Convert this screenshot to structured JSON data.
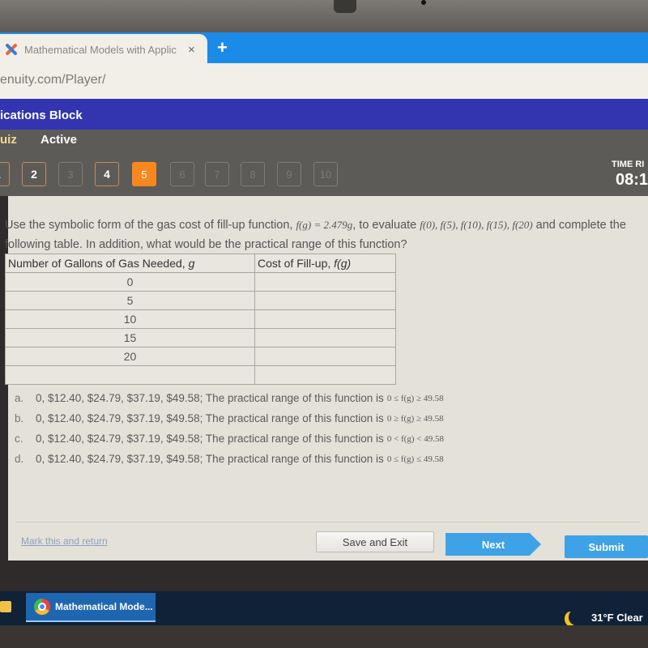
{
  "browser": {
    "tab_title": "Mathematical Models with Applic",
    "tab_close": "×",
    "new_tab": "+",
    "url": "enuity.com/Player/"
  },
  "course": {
    "title": "ications Block",
    "quiz_label": "uiz",
    "status": "Active"
  },
  "question_nav": [
    {
      "label": "1",
      "state": "answered"
    },
    {
      "label": "2",
      "state": "answered"
    },
    {
      "label": "3",
      "state": "unanswered"
    },
    {
      "label": "4",
      "state": "answered"
    },
    {
      "label": "5",
      "state": "current"
    },
    {
      "label": "6",
      "state": "unanswered"
    },
    {
      "label": "7",
      "state": "unanswered"
    },
    {
      "label": "8",
      "state": "unanswered"
    },
    {
      "label": "9",
      "state": "unanswered"
    },
    {
      "label": "10",
      "state": "unanswered"
    }
  ],
  "timer": {
    "label": "TIME RI",
    "value": "08:1"
  },
  "question": {
    "text_part1": "Use the symbolic form of the gas cost of fill-up function, ",
    "function_expr": "f(g) = 2.479g",
    "text_part2": ", to evaluate ",
    "evaluations": "f(0), f(5), f(10), f(15), f(20)",
    "text_part3": " and complete the following table. In addition, what would be the practical range of this function?"
  },
  "table": {
    "headers": [
      "Number of Gallons of Gas Needed, ",
      "Cost of Fill-up, "
    ],
    "header_vars": [
      "g",
      "f(g)"
    ],
    "rows": [
      {
        "g": "0",
        "f": ""
      },
      {
        "g": "5",
        "f": ""
      },
      {
        "g": "10",
        "f": ""
      },
      {
        "g": "15",
        "f": ""
      },
      {
        "g": "20",
        "f": ""
      },
      {
        "g": "",
        "f": ""
      }
    ]
  },
  "choices": [
    {
      "letter": "a.",
      "text": "0, $12.40, $24.79, $37.19, $49.58; The practical range of this function is",
      "range": "0 ≤ f(g) ≥ 49.58"
    },
    {
      "letter": "b.",
      "text": "0, $12.40, $24.79, $37.19, $49.58; The practical range of this function is",
      "range": "0 ≥ f(g) ≥ 49.58"
    },
    {
      "letter": "c.",
      "text": "0, $12.40, $24.79, $37.19, $49.58; The practical range of this function is",
      "range": "0 < f(g) < 49.58"
    },
    {
      "letter": "d.",
      "text": "0, $12.40, $24.79, $37.19, $49.58; The practical range of this function is",
      "range": "0 ≤ f(g) ≤ 49.58"
    }
  ],
  "footer": {
    "mark_link": "Mark this and return",
    "save_exit": "Save and Exit",
    "next": "Next",
    "submit": "Submit"
  },
  "taskbar": {
    "app_label": "Mathematical Mode...",
    "weather": "31°F  Clear"
  },
  "colors": {
    "course_bar": "#3234b0",
    "current_question": "#f7881f",
    "primary_button": "#3ea2e6"
  }
}
